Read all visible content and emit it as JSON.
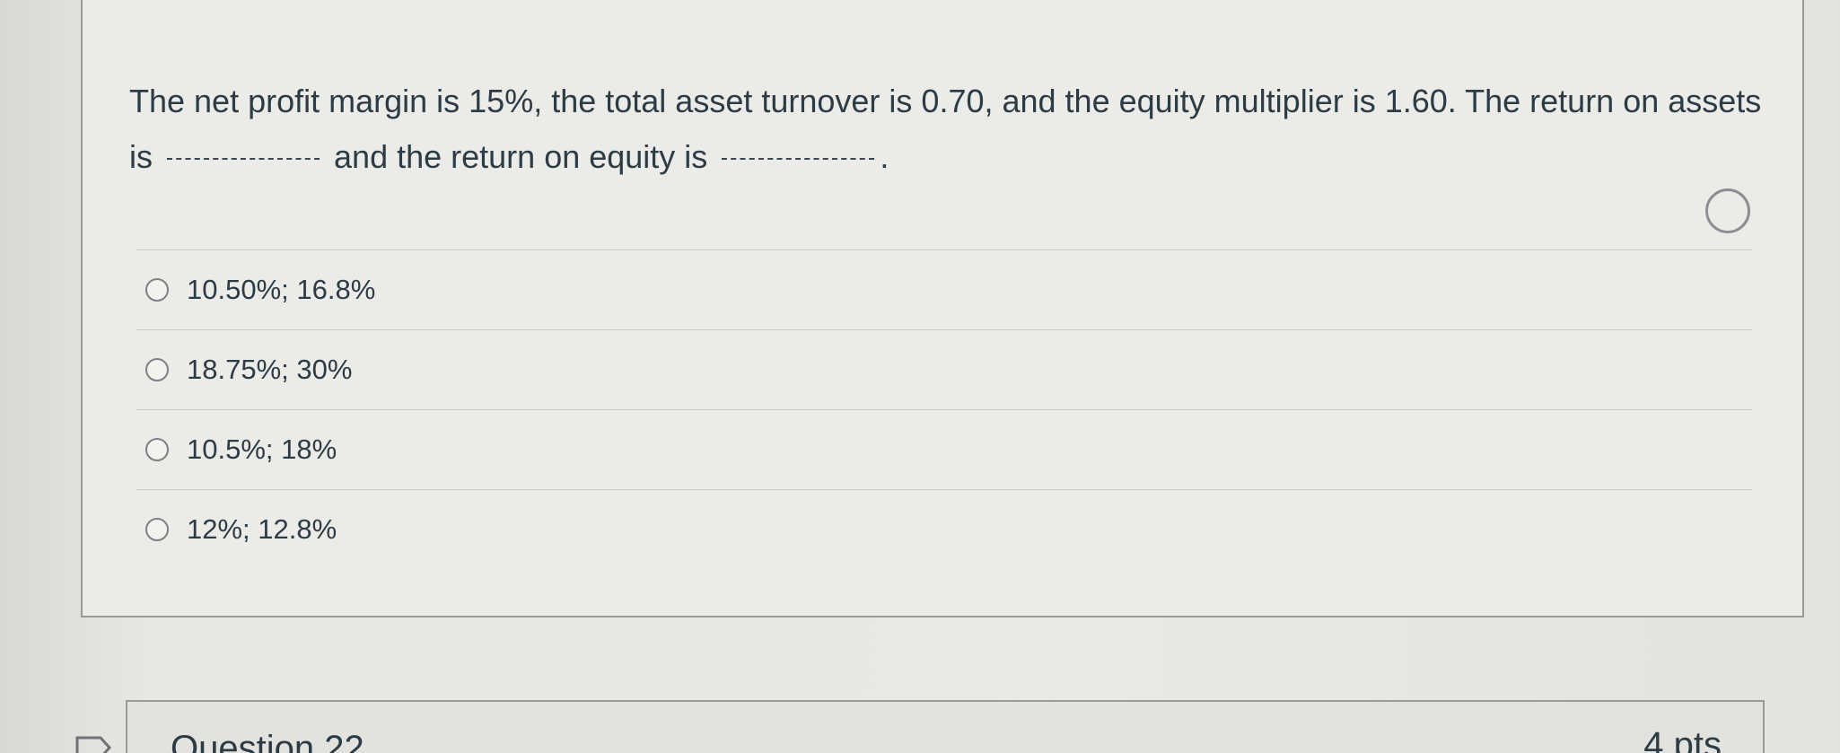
{
  "question": {
    "text_part1": "The net profit margin is 15%, the total asset turnover is 0.70, and the equity multiplier is 1.60. The return on assets is",
    "text_part2": "and the return on equity is",
    "text_end": "."
  },
  "answers": [
    {
      "label": "10.50%; 16.8%"
    },
    {
      "label": "18.75%; 30%"
    },
    {
      "label": "10.5%; 18%"
    },
    {
      "label": "12%; 12.8%"
    }
  ],
  "next_question": {
    "title": "Question 22",
    "points": "4 pts"
  }
}
